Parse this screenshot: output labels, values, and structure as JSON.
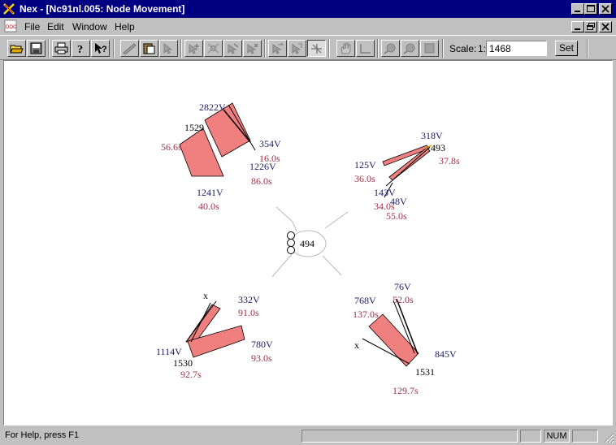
{
  "window": {
    "title": "Nex - [Nc91nl.005: Node Movement]",
    "minimize_icon": "minimize-icon",
    "maximize_icon": "maximize-icon",
    "close_icon": "close-icon",
    "restore_icon": "restore-icon"
  },
  "menu": {
    "items": [
      "File",
      "Edit",
      "Window",
      "Help"
    ]
  },
  "toolbar": {
    "buttons": [
      "open-icon",
      "save-icon",
      "print-icon",
      "help-icon",
      "context-help-icon",
      "ruler-icon",
      "paste-icon",
      "select-icon",
      "node-add-icon",
      "node-delete-icon",
      "link-add-icon",
      "link-delete-icon",
      "movement-left-icon",
      "movement-right-icon",
      "node-movement-icon",
      "pan-hand-icon",
      "axis-icon",
      "zoom-in-icon",
      "zoom-out-icon",
      "zoom-fit-icon"
    ],
    "scale_label": "Scale:",
    "scale_prefix": "1:",
    "scale_value": "1468",
    "set_label": "Set"
  },
  "diagram": {
    "center_node": "494",
    "groups": [
      {
        "node": "1529",
        "labels": [
          {
            "text": "2822V",
            "kind": "vol"
          },
          {
            "text": "1529",
            "kind": "node"
          },
          {
            "text": "56.6s",
            "kind": "time"
          },
          {
            "text": "354V",
            "kind": "vol"
          },
          {
            "text": "16.0s",
            "kind": "time"
          },
          {
            "text": "1226V",
            "kind": "vol"
          },
          {
            "text": "86.0s",
            "kind": "time"
          },
          {
            "text": "1241V",
            "kind": "vol"
          },
          {
            "text": "40.0s",
            "kind": "time"
          }
        ]
      },
      {
        "node": "493",
        "labels": [
          {
            "text": "318V",
            "kind": "vol"
          },
          {
            "text": "493",
            "kind": "node"
          },
          {
            "text": "37.8s",
            "kind": "time"
          },
          {
            "text": "125V",
            "kind": "vol"
          },
          {
            "text": "36.0s",
            "kind": "time"
          },
          {
            "text": "143V",
            "kind": "vol"
          },
          {
            "text": "48V",
            "kind": "vol"
          },
          {
            "text": "34.0s",
            "kind": "time"
          },
          {
            "text": "55.0s",
            "kind": "time"
          }
        ]
      },
      {
        "node": "1530",
        "labels": [
          {
            "text": "x",
            "kind": "node"
          },
          {
            "text": "332V",
            "kind": "vol"
          },
          {
            "text": "91.0s",
            "kind": "time"
          },
          {
            "text": "780V",
            "kind": "vol"
          },
          {
            "text": "93.0s",
            "kind": "time"
          },
          {
            "text": "1114V",
            "kind": "vol"
          },
          {
            "text": "1530",
            "kind": "node"
          },
          {
            "text": "92.7s",
            "kind": "time"
          }
        ]
      },
      {
        "node": "1531",
        "labels": [
          {
            "text": "76V",
            "kind": "vol"
          },
          {
            "text": "52.0s",
            "kind": "time"
          },
          {
            "text": "768V",
            "kind": "vol"
          },
          {
            "text": "137.0s",
            "kind": "time"
          },
          {
            "text": "x",
            "kind": "node"
          },
          {
            "text": "845V",
            "kind": "vol"
          },
          {
            "text": "1531",
            "kind": "node"
          },
          {
            "text": "129.7s",
            "kind": "time"
          }
        ]
      }
    ]
  },
  "colors": {
    "flow_fill": "#f08080",
    "volume_text": "#1a1a66",
    "time_text": "#a0304a"
  },
  "status": {
    "help_text": "For Help, press F1",
    "num_indicator": "NUM"
  }
}
